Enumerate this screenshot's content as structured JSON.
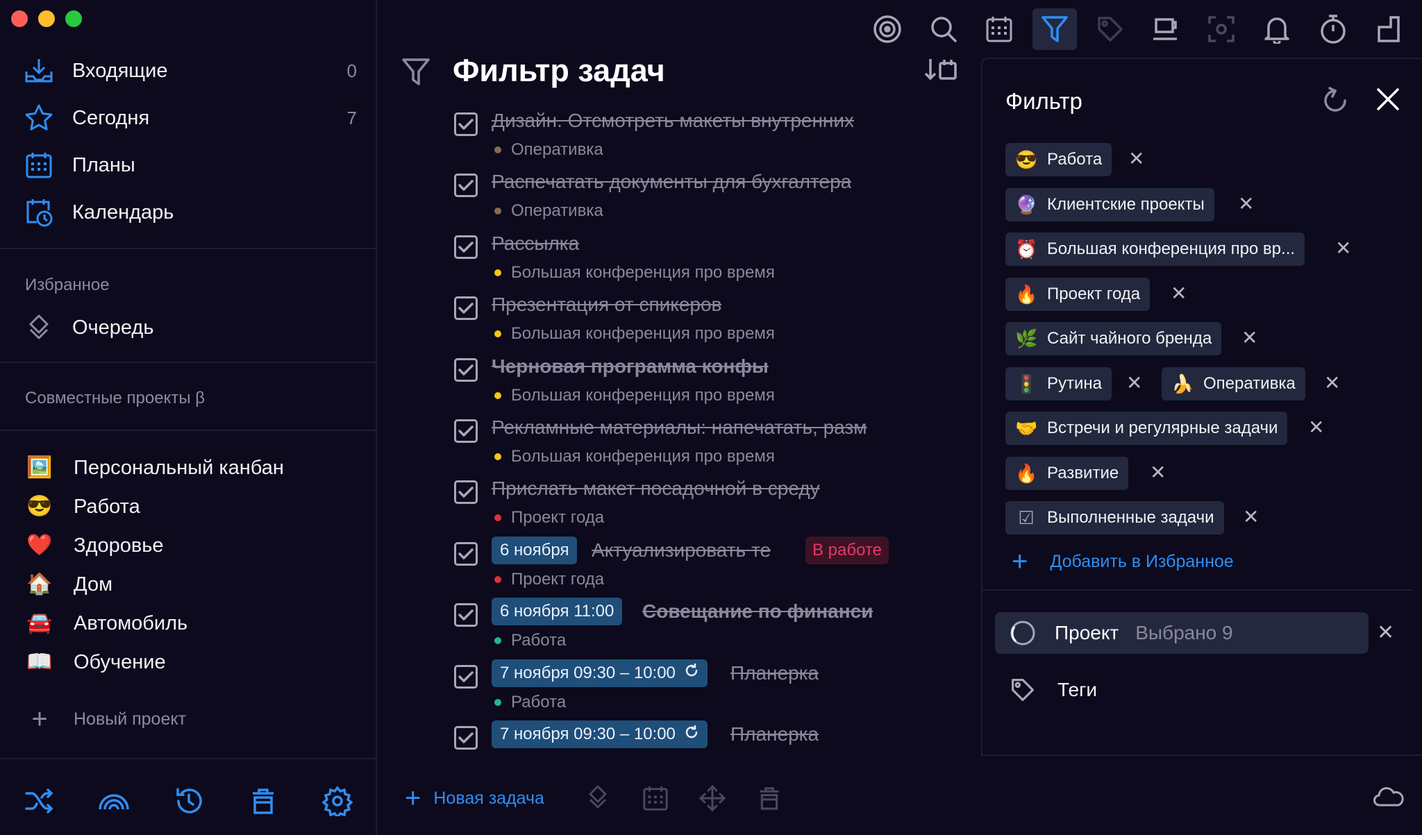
{
  "sidebar": {
    "nav": [
      {
        "label": "Входящие",
        "count": "0"
      },
      {
        "label": "Сегодня",
        "count": "7"
      },
      {
        "label": "Планы",
        "count": ""
      },
      {
        "label": "Календарь",
        "count": ""
      }
    ],
    "favorites_title": "Избранное",
    "favorites": [
      {
        "label": "Очередь"
      }
    ],
    "shared_title": "Совместные проекты β",
    "projects": [
      {
        "emoji": "🖼️",
        "label": "Персональный канбан"
      },
      {
        "emoji": "😎",
        "label": "Работа"
      },
      {
        "emoji": "❤️",
        "label": "Здоровье"
      },
      {
        "emoji": "🏠",
        "label": "Дом"
      },
      {
        "emoji": "🚘",
        "label": "Автомобиль"
      },
      {
        "emoji": "📖",
        "label": "Обучение"
      }
    ],
    "new_project": "Новый проект"
  },
  "main": {
    "title": "Фильтр задач",
    "tasks": [
      {
        "title": "Дизайн. Отсмотреть макеты внутренних",
        "project": "Оперативка",
        "dot": "#8b6a4e"
      },
      {
        "title": "Распечатать документы для бухгалтера",
        "project": "Оперативка",
        "dot": "#8b6a4e"
      },
      {
        "title": "Рассылка",
        "project": "Большая конференция про время",
        "dot": "#f5c518"
      },
      {
        "title": "Презентация от спикеров",
        "project": "Большая конференция про время",
        "dot": "#f5c518"
      },
      {
        "title": "Черновая программа конфы",
        "project": "Большая конференция про время",
        "dot": "#f5c518"
      },
      {
        "title": "Рекламные материалы: напечатать, разм",
        "project": "Большая конференция про время",
        "dot": "#f5c518"
      },
      {
        "title": "Прислать макет посадочной в среду",
        "project": "Проект года",
        "dot": "#e0303a"
      },
      {
        "date": "6 ноября",
        "title": "Актуализировать те",
        "status": "В работе",
        "project": "Проект года",
        "dot": "#e0303a"
      },
      {
        "date": "6 ноября 11:00",
        "title": "Совещание по финанси",
        "project": "Работа",
        "dot": "#25b58f"
      },
      {
        "date": "7 ноября 09:30 – 10:00",
        "title": "Планерка",
        "project": "Работа",
        "dot": "#25b58f"
      },
      {
        "date": "7 ноября 09:30 – 10:00",
        "title": "Планерка"
      }
    ],
    "new_task": "Новая задача"
  },
  "filter": {
    "title": "Фильтр",
    "chips": [
      {
        "emoji": "😎",
        "label": "Работа"
      },
      {
        "emoji": "🔮",
        "label": "Клиентские проекты"
      },
      {
        "emoji": "⏰",
        "label": "Большая конференция про вр..."
      },
      {
        "emoji": "🔥",
        "label": "Проект года"
      },
      {
        "emoji": "🌿",
        "label": "Сайт чайного бренда"
      },
      {
        "emoji": "🚦",
        "label": "Рутина"
      },
      {
        "emoji": "🍌",
        "label": "Оперативка"
      },
      {
        "emoji": "🤝",
        "label": "Встречи и регулярные задачи"
      },
      {
        "emoji": "🔥",
        "label": "Развитие"
      },
      {
        "emoji": "☑",
        "label": "Выполненные задачи"
      }
    ],
    "add_favorite": "Добавить в Избранное",
    "project_label": "Проект",
    "project_value": "Выбрано 9",
    "tags_label": "Теги"
  },
  "colors": {
    "accent": "#2f8ef4",
    "chip_bg": "#23283e",
    "date_badge": "#1f4e79",
    "status_badge_text": "#e23a6b"
  }
}
